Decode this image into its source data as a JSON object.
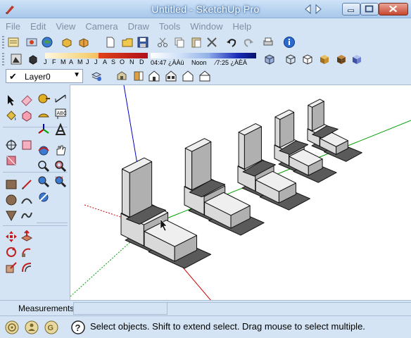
{
  "window": {
    "title": "Untitled - SketchUp Pro"
  },
  "menu": {
    "items": [
      "File",
      "Edit",
      "View",
      "Camera",
      "Draw",
      "Tools",
      "Window",
      "Help"
    ]
  },
  "shadows": {
    "months": [
      "J",
      "F",
      "M",
      "A",
      "M",
      "J",
      "J",
      "A",
      "S",
      "O",
      "N",
      "D"
    ],
    "time_start": "04:47 ¿ÀÀü",
    "time_noon": "Noon",
    "time_end": "⁄7:25 ¿ÀÈÄ"
  },
  "layers": {
    "current": "Layer0"
  },
  "measurements": {
    "label": "Measurements",
    "value": ""
  },
  "status": {
    "message": "Select objects. Shift to extend select. Drag mouse to select multiple."
  },
  "colors": {
    "chrome": "#d4e4f4",
    "viewport_bg": "#ffffff",
    "axis_red": "#cc0000",
    "axis_green": "#00a000",
    "axis_blue": "#0000cc"
  },
  "icons": [
    "sketchup-logo-icon",
    "select-icon",
    "eraser-icon",
    "paint-bucket-icon",
    "make-component-icon",
    "line-icon",
    "freehand-icon",
    "rectangle-icon",
    "circle-icon",
    "arc-icon",
    "polygon-icon",
    "orbit-icon",
    "pan-icon",
    "zoom-icon",
    "zoom-window-icon",
    "zoom-extents-icon",
    "push-pull-icon",
    "move-icon",
    "rotate-icon",
    "scale-icon",
    "offset-icon",
    "follow-me-icon",
    "tape-measure-icon",
    "text-icon",
    "axes-icon",
    "dimension-icon",
    "protractor-icon",
    "3d-text-icon",
    "walk-icon",
    "look-around-icon",
    "position-camera-icon",
    "section-plane-icon",
    "undo-icon",
    "redo-icon",
    "print-icon",
    "model-info-icon",
    "help-icon",
    "geo-location-icon",
    "credits-icon"
  ]
}
